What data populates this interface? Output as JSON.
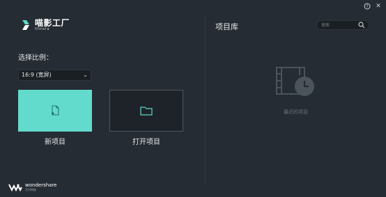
{
  "app": {
    "logo_cn": "喵影工厂",
    "logo_en": "filmora"
  },
  "left": {
    "ratio_label": "选择比例：",
    "ratio_value": "16:9 (宽屏)",
    "new_project_label": "新项目",
    "open_project_label": "打开项目"
  },
  "footer": {
    "brand_en": "wondershare",
    "brand_cn": "万兴科技"
  },
  "library": {
    "title": "项目库",
    "search_placeholder": "搜索",
    "empty_text": "最近的项目"
  },
  "window": {
    "help_glyph": "?",
    "close_glyph": "✕"
  },
  "colors": {
    "background": "#262c33",
    "accent": "#62dbcd",
    "panel": "#1a1f24"
  }
}
